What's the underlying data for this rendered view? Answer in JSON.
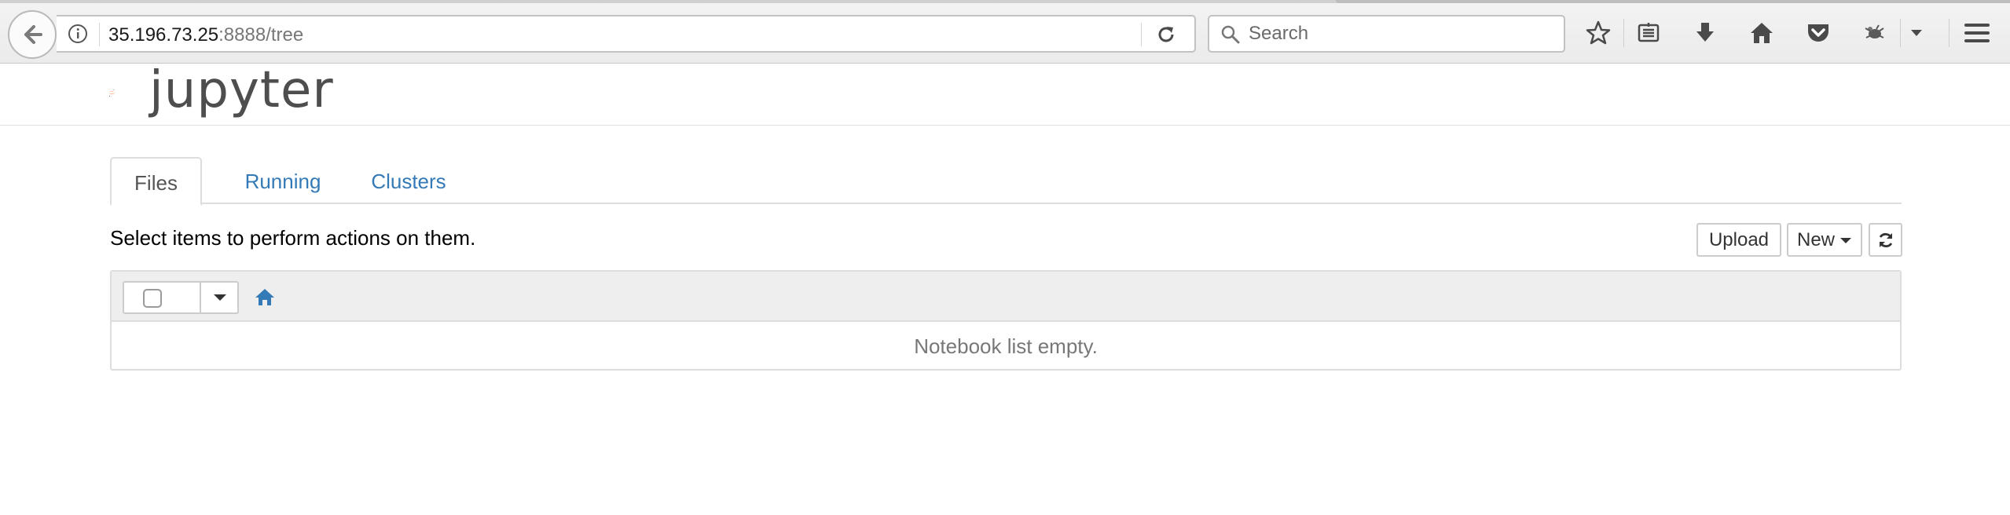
{
  "browser": {
    "url_host": "35.196.73.25",
    "url_path": ":8888/tree",
    "search_placeholder": "Search"
  },
  "jupyter": {
    "logo_text": "jupyter",
    "tabs": [
      {
        "label": "Files",
        "active": true
      },
      {
        "label": "Running",
        "active": false
      },
      {
        "label": "Clusters",
        "active": false
      }
    ],
    "instructions": "Select items to perform actions on them.",
    "upload_label": "Upload",
    "new_label": "New",
    "empty_message": "Notebook list empty."
  },
  "colors": {
    "link": "#337ab7",
    "logo_orange": "#f37726"
  }
}
